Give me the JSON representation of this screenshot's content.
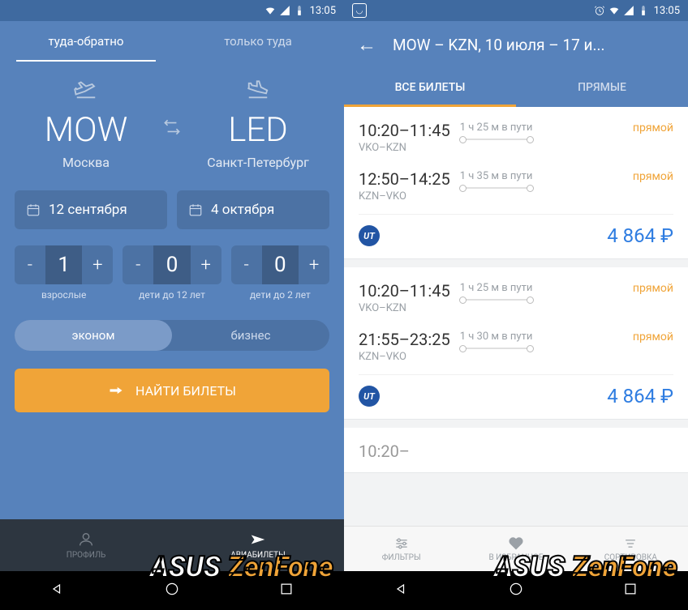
{
  "status": {
    "time": "13:05"
  },
  "left": {
    "tabs": {
      "roundtrip": "туда-обратно",
      "oneway": "только туда"
    },
    "origin": {
      "code": "MOW",
      "city": "Москва"
    },
    "destination": {
      "code": "LED",
      "city": "Санкт-Петербург"
    },
    "dates": {
      "depart": "12 сентября",
      "return": "4 октября"
    },
    "passengers": {
      "adults": {
        "value": "1",
        "label": "взрослые"
      },
      "children": {
        "value": "0",
        "label": "дети до 12 лет"
      },
      "infants": {
        "value": "0",
        "label": "дети до 2 лет"
      }
    },
    "cabin": {
      "economy": "эконом",
      "business": "бизнес"
    },
    "search_label": "НАЙТИ БИЛЕТЫ",
    "nav": {
      "profile": "ПРОФИЛЬ",
      "tickets": "АВИАБИЛЕТЫ"
    }
  },
  "right": {
    "title": "MOW – KZN, 10 июля – 17 и...",
    "tabs": {
      "all": "ВСЕ БИЛЕТЫ",
      "direct": "ПРЯМЫЕ"
    },
    "direct_label": "прямой",
    "cards": [
      {
        "leg1": {
          "times": "10:20–11:45",
          "route": "VKO–KZN",
          "duration": "1 ч 25 м в пути"
        },
        "leg2": {
          "times": "12:50–14:25",
          "route": "KZN–VKO",
          "duration": "1 ч 35 м в пути"
        },
        "price": "4 864 ₽"
      },
      {
        "leg1": {
          "times": "10:20–11:45",
          "route": "VKO–KZN",
          "duration": "1 ч 25 м в пути"
        },
        "leg2": {
          "times": "21:55–23:25",
          "route": "KZN–VKO",
          "duration": "1 ч 30 м в пути"
        },
        "price": "4 864 ₽"
      }
    ],
    "footer": {
      "filters": "ФИЛЬТРЫ",
      "favorite": "В ИЗБРАННОЕ",
      "sort": "СОРТИРОВКА"
    }
  },
  "watermark": {
    "brand": "ASUS",
    "model": "ZenFone"
  }
}
